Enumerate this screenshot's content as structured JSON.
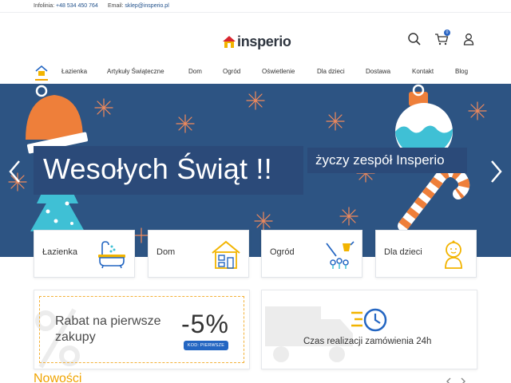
{
  "topbar": {
    "phone_label": "Infolinia:",
    "phone_value": "+48 534 450 764",
    "email_label": "Email:",
    "email_value": "sklep@insperio.pl"
  },
  "header": {
    "logo_text": "insperio",
    "cart_count": "0",
    "icons": [
      "search-icon",
      "cart-icon",
      "user-icon"
    ]
  },
  "nav": {
    "items": [
      {
        "label": "Łazienka"
      },
      {
        "label": "Artykuły Świąteczne"
      },
      {
        "label": "Dom"
      },
      {
        "label": "Ogród"
      },
      {
        "label": "Oświetlenie"
      },
      {
        "label": "Dla dzieci"
      },
      {
        "label": "Dostawa"
      },
      {
        "label": "Kontakt"
      },
      {
        "label": "Blog"
      }
    ]
  },
  "hero": {
    "title": "Wesołych Świąt !!",
    "subtitle": "życzy zespół Insperio",
    "prev_icon": "chevron-left-icon",
    "next_icon": "chevron-right-icon"
  },
  "categories": [
    {
      "label": "Łazienka",
      "icon": "bathtub-icon"
    },
    {
      "label": "Dom",
      "icon": "house-icon"
    },
    {
      "label": "Ogród",
      "icon": "garden-tools-icon"
    },
    {
      "label": "Dla dzieci",
      "icon": "baby-icon"
    }
  ],
  "promo": {
    "text": "Rabat na pierwsze zakupy",
    "discount": "-5%",
    "code": "KOD: PIERWSZE"
  },
  "delivery": {
    "text": "Czas realizacji zamówienia 24h",
    "icon": "fast-clock-icon"
  },
  "news": {
    "heading": "Nowości"
  },
  "colors": {
    "hero_bg": "#2d5483",
    "accent_orange": "#f0a400",
    "accent_blue": "#2466c2",
    "logo_red": "#d8262f"
  }
}
